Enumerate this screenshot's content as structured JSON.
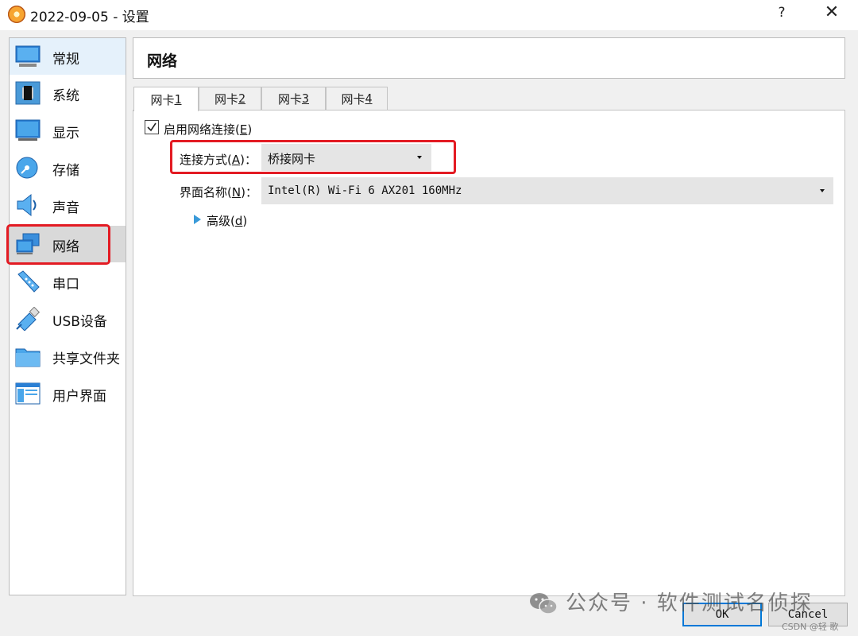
{
  "window": {
    "title": "2022-09-05 - 设置",
    "help_label": "?",
    "close_label": "✕"
  },
  "sidebar": {
    "items": [
      {
        "label": "常规",
        "icon": "general-icon"
      },
      {
        "label": "系统",
        "icon": "system-icon"
      },
      {
        "label": "显示",
        "icon": "display-icon"
      },
      {
        "label": "存储",
        "icon": "storage-icon"
      },
      {
        "label": "声音",
        "icon": "audio-icon"
      },
      {
        "label": "网络",
        "icon": "network-icon"
      },
      {
        "label": "串口",
        "icon": "serial-port-icon"
      },
      {
        "label": "USB设备",
        "icon": "usb-icon"
      },
      {
        "label": "共享文件夹",
        "icon": "shared-folder-icon"
      },
      {
        "label": "用户界面",
        "icon": "user-interface-icon"
      }
    ],
    "selected": "网络"
  },
  "header": {
    "title": "网络"
  },
  "tabs": [
    {
      "label": "网卡 ",
      "key": "1"
    },
    {
      "label": "网卡 ",
      "key": "2"
    },
    {
      "label": "网卡 ",
      "key": "3"
    },
    {
      "label": "网卡 ",
      "key": "4"
    }
  ],
  "adapter": {
    "enable_label": "启用网络连接(",
    "enable_key": "E",
    "enable_suffix": ")",
    "enabled": true,
    "attached_label": "连接方式(",
    "attached_key": "A",
    "attached_suffix": ")：",
    "attached_value": "桥接网卡",
    "name_label": "界面名称(",
    "name_key": "N",
    "name_suffix": ")：",
    "name_value": "Intel(R) Wi-Fi 6 AX201 160MHz",
    "advanced_label": "高级(",
    "advanced_key": "d",
    "advanced_suffix": ")"
  },
  "buttons": {
    "ok": "OK",
    "cancel": "Cancel"
  },
  "watermark": {
    "text": "公众号 · 软件测试名侦探",
    "csdn": "CSDN @轻  歌"
  },
  "colors": {
    "highlight": "#e31b23",
    "accent": "#0078d7",
    "arrow": "#3a9ad9"
  }
}
